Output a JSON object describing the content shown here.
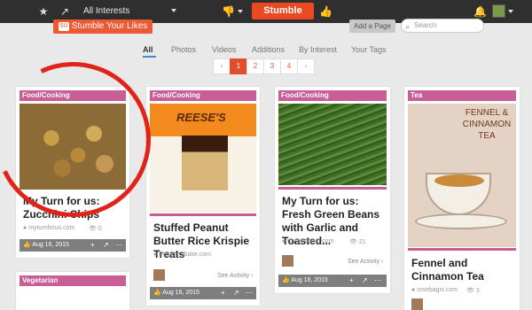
{
  "topbar": {
    "interests_label": "All Interests",
    "stumble_label": "Stumble"
  },
  "actions": {
    "likes_label": "Stumble Your Likes",
    "likes_badge": "SU",
    "add_page_label": "Add a Page",
    "search_placeholder": "Search"
  },
  "filters": [
    "All",
    "Photos",
    "Videos",
    "Additions",
    "By Interest",
    "Your Tags"
  ],
  "pagination": {
    "prev": "‹",
    "pages": [
      "1",
      "2",
      "3",
      "4"
    ],
    "current": "1",
    "next": "›"
  },
  "cards": [
    {
      "tag": "Food/Cooking",
      "title": "My Turn for us: Zucchini Chips",
      "source": "myturnforus.com",
      "count": "0",
      "date": "Aug 16, 2015"
    },
    {
      "tag": "Food/Cooking",
      "title": "Stuffed Peanut Butter Rice Krispie Treats",
      "source": "thebkin...bake.com",
      "see_activity": "See Activity ›",
      "date": "Aug 16, 2015",
      "image_text": "REESE'S"
    },
    {
      "tag": "Food/Cooking",
      "title": "My Turn for us: Fresh Green Beans with Garlic and Toasted...",
      "source": "myturnforus.com",
      "count": "21",
      "see_activity": "See Activity ›",
      "date": "Aug 16, 2015"
    },
    {
      "tag": "Tea",
      "title": "Fennel and Cinnamon Tea",
      "source": "rosebagni.com",
      "count": "3",
      "image_text": "FENNEL & CINNAMON TEA"
    },
    {
      "tag": "Vegetarian"
    }
  ],
  "colors": {
    "accent": "#eb4924",
    "tag": "#c95e96",
    "highlight_circle": "#e2231a"
  }
}
